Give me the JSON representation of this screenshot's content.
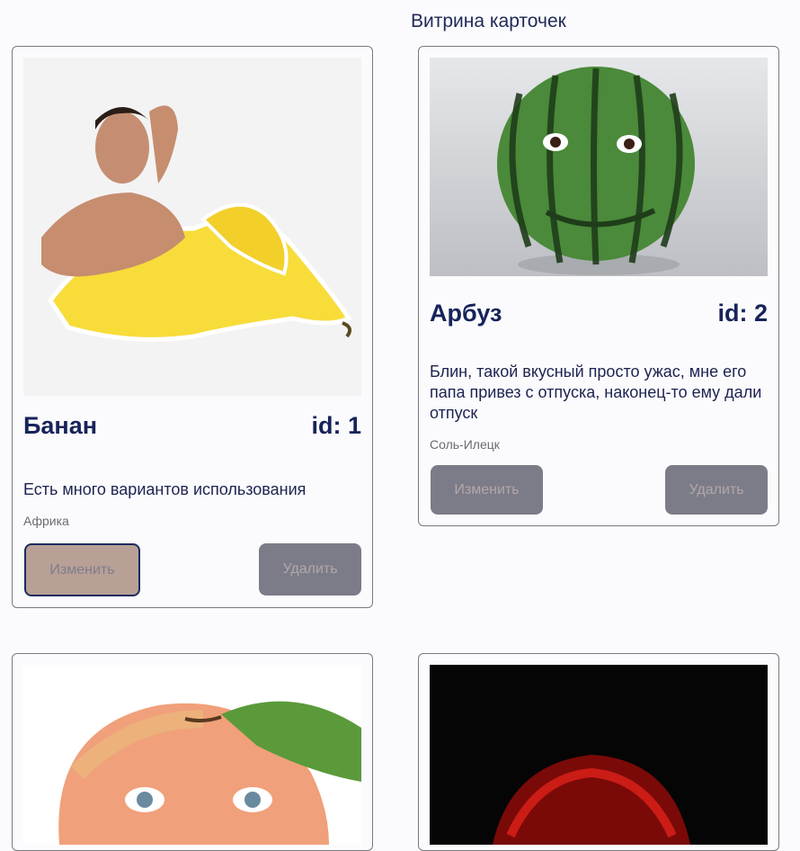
{
  "page": {
    "title": "Витрина карточек"
  },
  "cards": [
    {
      "name": "Банан",
      "id_label": "id: 1",
      "description": "Есть много вариантов использования",
      "place": "Африка",
      "edit_label": "Изменить",
      "delete_label": "Удалить",
      "image": "banana-with-man-image"
    },
    {
      "name": "Арбуз",
      "id_label": "id: 2",
      "description": "Блин, такой вкусный просто ужас, мне его папа привез с отпуска, наконец-то ему дали отпуск",
      "place": "Соль-Илецк",
      "edit_label": "Изменить",
      "delete_label": "Удалить",
      "image": "watermelon-face-image"
    },
    {
      "image": "peach-baby-face-image"
    },
    {
      "image": "red-glowing-head-image"
    }
  ],
  "colors": {
    "title": "#17245a",
    "button": "#7b7c88",
    "button_active": "#b8a097",
    "border_active": "#1c2b5e"
  }
}
